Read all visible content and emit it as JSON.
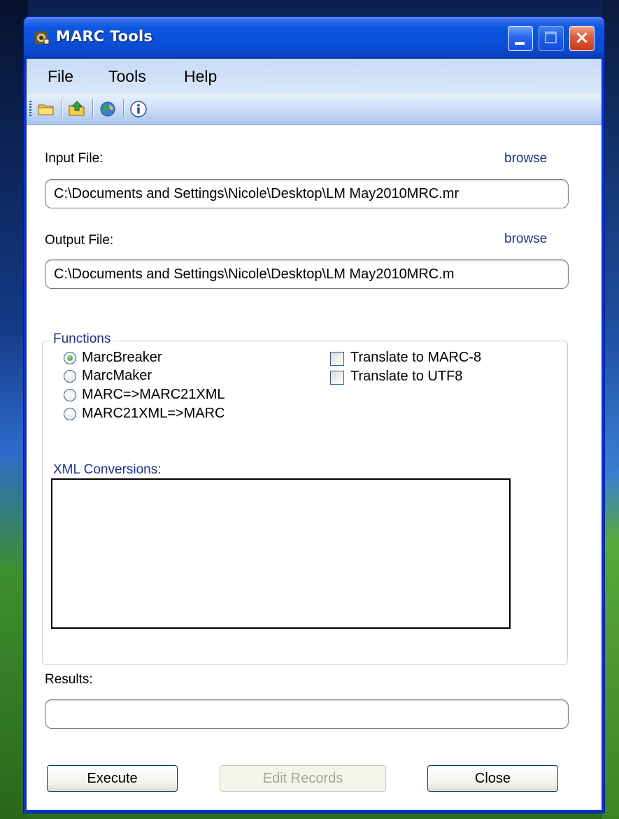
{
  "window": {
    "title": "MARC Tools",
    "controls": {
      "minimize": "minimize",
      "maximize": "maximize",
      "close": "×"
    }
  },
  "menu": {
    "items": [
      "File",
      "Tools",
      "Help"
    ]
  },
  "toolbar": {
    "icons": [
      "open-folder-icon",
      "save-icon",
      "web-icon",
      "info-icon"
    ]
  },
  "input": {
    "label": "Input File:",
    "browse": "browse",
    "value": "C:\\Documents and Settings\\Nicole\\Desktop\\LM  May2010MRC.mr"
  },
  "output": {
    "label": "Output File:",
    "browse": "browse",
    "value": "C:\\Documents and Settings\\Nicole\\Desktop\\LM  May2010MRC.m"
  },
  "functions": {
    "title": "Functions",
    "radios": [
      {
        "label": "MarcBreaker",
        "checked": true
      },
      {
        "label": "MarcMaker",
        "checked": false
      },
      {
        "label": "MARC=>MARC21XML",
        "checked": false
      },
      {
        "label": "MARC21XML=>MARC",
        "checked": false
      }
    ],
    "checkboxes": [
      {
        "label": "Translate to MARC-8",
        "checked": false
      },
      {
        "label": "Translate to UTF8",
        "checked": false
      }
    ],
    "xml_title": "XML Conversions:"
  },
  "results": {
    "label": "Results:",
    "value": ""
  },
  "buttons": {
    "execute": "Execute",
    "edit": "Edit Records",
    "close": "Close"
  },
  "colors": {
    "title_blue": "#0a4fd8",
    "link_blue": "#1b2f8a",
    "group_title_blue": "#1d2f9a",
    "close_red": "#c9391a"
  }
}
